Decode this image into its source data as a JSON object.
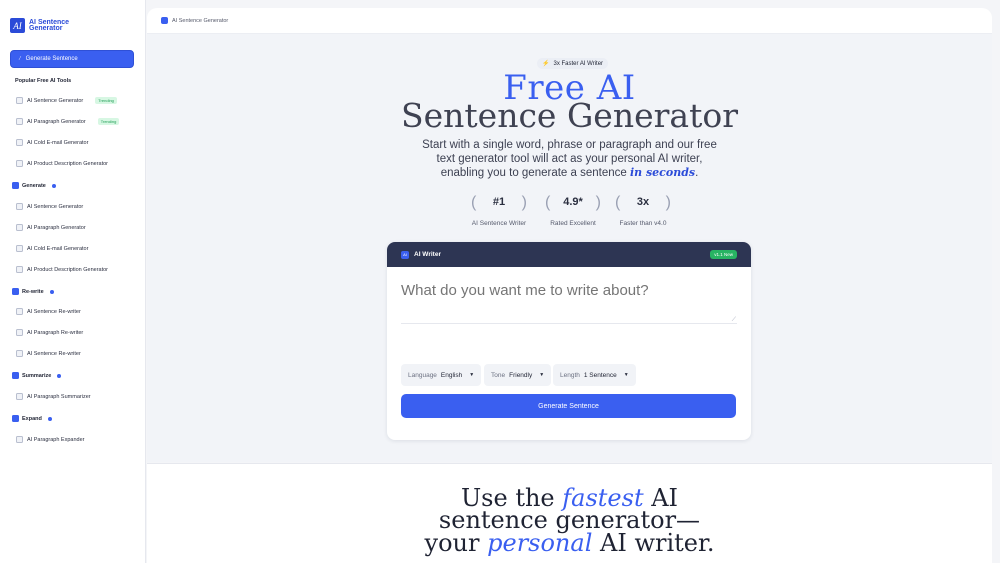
{
  "logo": {
    "mark": "AI",
    "text": "AI Sentence Generator"
  },
  "sidebar": {
    "primary_button": "Generate Sentence",
    "popular_heading": "Popular Free AI Tools",
    "popular": [
      {
        "label": "AI Sentence Generator",
        "badge": "Trending"
      },
      {
        "label": "AI Paragraph Generator",
        "badge": "Trending"
      },
      {
        "label": "AI Cold E-mail Generator",
        "badge": ""
      },
      {
        "label": "AI Product Description Generator",
        "badge": ""
      }
    ],
    "sections": [
      {
        "title": "Generate",
        "items": [
          "AI Sentence Generator",
          "AI Paragraph Generator",
          "AI Cold E-mail Generator",
          "AI Product Description Generator"
        ]
      },
      {
        "title": "Re-write",
        "items": [
          "AI Sentence Re-writer",
          "AI Paragraph Re-writer",
          "AI Sentence Re-writer"
        ]
      },
      {
        "title": "Summarize",
        "items": [
          "AI Paragraph Summarizer"
        ]
      },
      {
        "title": "Expand",
        "items": [
          "AI Paragraph Expander"
        ]
      }
    ]
  },
  "topbar": {
    "breadcrumb": "AI Sentence Generator"
  },
  "hero": {
    "pill": "3x Faster AI Writer",
    "title_accent": "Free AI",
    "title_main": "Sentence Generator",
    "description": "Start with a single word, phrase or paragraph and our free text generator tool will act as your personal AI writer, enabling you to generate a sentence",
    "description_emphasis": "in seconds",
    "description_end": ".",
    "stats": [
      {
        "value": "#1",
        "label": "AI Sentence Writer"
      },
      {
        "value": "4.9*",
        "label": "Rated Excellent"
      },
      {
        "value": "3x",
        "label": "Faster than v4.0"
      }
    ]
  },
  "writer": {
    "title": "AI Writer",
    "icon": "AI",
    "version_badge": "v1.1 New",
    "placeholder": "What do you want me to write about?",
    "language": {
      "label": "Language",
      "value": "English"
    },
    "tone": {
      "label": "Tone",
      "value": "Friendly"
    },
    "length": {
      "label": "Length",
      "value": "1 Sentence"
    },
    "button": "Generate Sentence"
  },
  "bottom": {
    "line1_a": "Use the ",
    "line1_it": "fastest",
    "line1_b": " AI",
    "line2": "sentence generator—",
    "line3_a": "your ",
    "line3_it": "personal",
    "line3_b": " AI writer."
  },
  "colors": {
    "accent": "#3a5ff0",
    "header": "#2d3553",
    "trending": "#1f9d55"
  }
}
